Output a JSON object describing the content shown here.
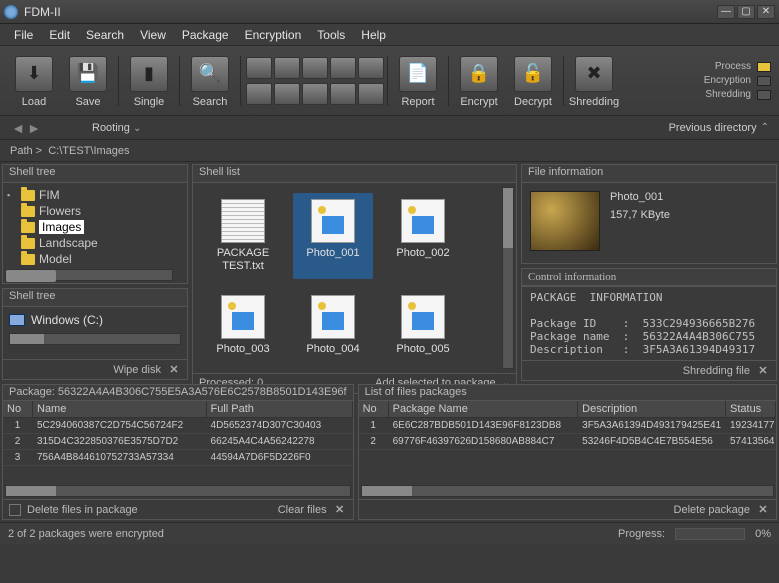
{
  "app": {
    "title": "FDM-II"
  },
  "menu": [
    "File",
    "Edit",
    "Search",
    "View",
    "Package",
    "Encryption",
    "Tools",
    "Help"
  ],
  "toolbar": {
    "load": "Load",
    "save": "Save",
    "single": "Single",
    "search": "Search",
    "report": "Report",
    "encrypt": "Encrypt",
    "decrypt": "Decrypt",
    "shredding": "Shredding"
  },
  "indicators": {
    "process": "Process",
    "encryption": "Encryption",
    "shredding": "Shredding"
  },
  "nav": {
    "rooting": "Rooting",
    "previous": "Previous directory"
  },
  "path": {
    "prefix": "Path  >",
    "value": "C:\\TEST\\Images"
  },
  "shell_tree": {
    "title": "Shell tree",
    "items": [
      {
        "label": "FIM",
        "expandable": true
      },
      {
        "label": "Flowers"
      },
      {
        "label": "Images",
        "selected": true
      },
      {
        "label": "Landscape"
      },
      {
        "label": "Model"
      }
    ]
  },
  "drives_panel": {
    "title": "Shell tree",
    "drive": "Windows (C:)",
    "wipe": "Wipe disk"
  },
  "shell_list": {
    "title": "Shell list",
    "items": [
      {
        "name": "PACKAGE TEST.txt",
        "kind": "txt"
      },
      {
        "name": "Photo_001",
        "kind": "img",
        "selected": true
      },
      {
        "name": "Photo_002",
        "kind": "img"
      },
      {
        "name": "Photo_003",
        "kind": "img"
      },
      {
        "name": "Photo_004",
        "kind": "img"
      },
      {
        "name": "Photo_005",
        "kind": "img"
      }
    ],
    "processed": "Processed: 0",
    "add": "Add selected to package"
  },
  "file_info": {
    "title": "File information",
    "name": "Photo_001",
    "size": "157,7 KByte"
  },
  "control_info": {
    "title": "Control information",
    "heading": "PACKAGE  INFORMATION",
    "lines": [
      "Package ID    :  533C294936665B276",
      "Package name  :  56322A4A4B306C755",
      "Description   :  3F5A3A61394D49317"
    ],
    "shredding": "Shredding file"
  },
  "pkg_table": {
    "title": "Package: 56322A4A4B306C755E5A3A576E6C2578B8501D143E96f",
    "cols": [
      "No",
      "Name",
      "Full Path"
    ],
    "rows": [
      [
        "1",
        "5C294060387C2D754C56724F2",
        "4D5652374D307C30403"
      ],
      [
        "2",
        "315D4C322850376E3575D7D2",
        "66245A4C4A56242278"
      ],
      [
        "3",
        "756A4B844610752733A57334",
        "44594A7D6F5D226F0"
      ]
    ],
    "delete": "Delete files in package",
    "clear": "Clear files"
  },
  "files_table": {
    "title": "List of files packages",
    "cols": [
      "No",
      "Package Name",
      "Description",
      "Status"
    ],
    "rows": [
      [
        "1",
        "6E6C287BDB501D143E96F8123DB8",
        "3F5A3A61394D493179425E41",
        "19234177"
      ],
      [
        "2",
        "69776F46397626D158680AB884C7",
        "53246F4D5B4C4E7B554E56",
        "57413564"
      ]
    ],
    "delete": "Delete package"
  },
  "status": {
    "msg": "2 of 2 packages were encrypted",
    "progress_label": "Progress:",
    "progress_value": "0%"
  }
}
